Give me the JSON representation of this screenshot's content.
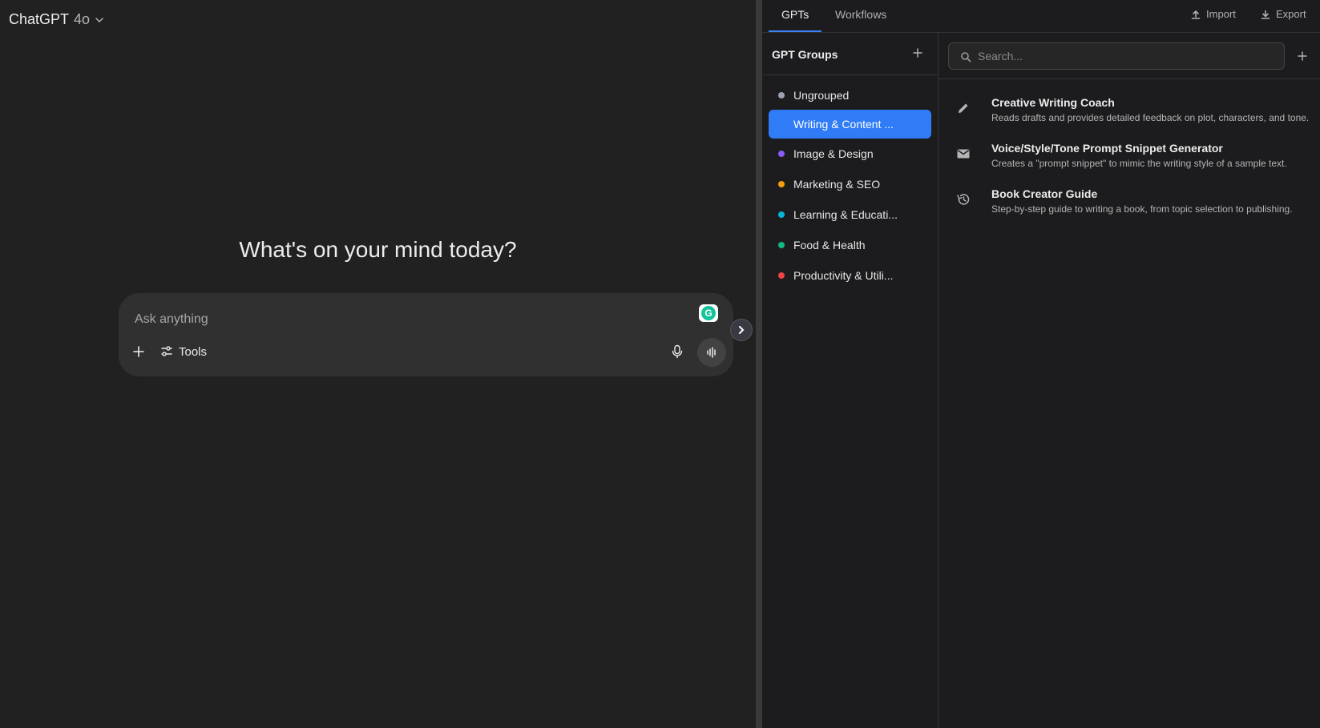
{
  "header": {
    "model_name": "ChatGPT",
    "model_version": "4o"
  },
  "chat": {
    "headline": "What's on your mind today?",
    "composer_placeholder": "Ask anything",
    "tools_label": "Tools",
    "icons": [
      "plus-icon",
      "sliders-icon",
      "mic-icon",
      "voice-wave-icon",
      "grammarly-icon",
      "chevron-right-icon"
    ]
  },
  "panel": {
    "tabs": [
      {
        "label": "GPTs",
        "active": true
      },
      {
        "label": "Workflows",
        "active": false
      }
    ],
    "import_label": "Import",
    "export_label": "Export",
    "groups_title": "GPT Groups",
    "groups": [
      {
        "label": "Ungrouped",
        "color": "#9ca3af",
        "active": false
      },
      {
        "label": "Writing & Content ...",
        "color": "#2f7cf6",
        "active": true
      },
      {
        "label": "Image & Design",
        "color": "#8b5cf6",
        "active": false
      },
      {
        "label": "Marketing & SEO",
        "color": "#f59e0b",
        "active": false
      },
      {
        "label": "Learning & Educati...",
        "color": "#06b6d4",
        "active": false
      },
      {
        "label": "Food & Health",
        "color": "#10b981",
        "active": false
      },
      {
        "label": "Productivity & Utili...",
        "color": "#ef4444",
        "active": false
      }
    ],
    "search_placeholder": "Search...",
    "gpts": [
      {
        "name": "Creative Writing Coach",
        "description": "Reads drafts and provides detailed feedback on plot, characters, and tone.",
        "icon": "pencil-icon"
      },
      {
        "name": "Voice/Style/Tone Prompt Snippet Generator",
        "description": "Creates a \"prompt snippet\" to mimic the writing style of a sample text.",
        "icon": "mail-icon"
      },
      {
        "name": "Book Creator Guide",
        "description": "Step-by-step guide to writing a book, from topic selection to publishing.",
        "icon": "history-icon"
      }
    ]
  },
  "colors": {
    "accent": "#2f7cf6",
    "background": "#212121",
    "panel_background": "#1c1c1e"
  }
}
